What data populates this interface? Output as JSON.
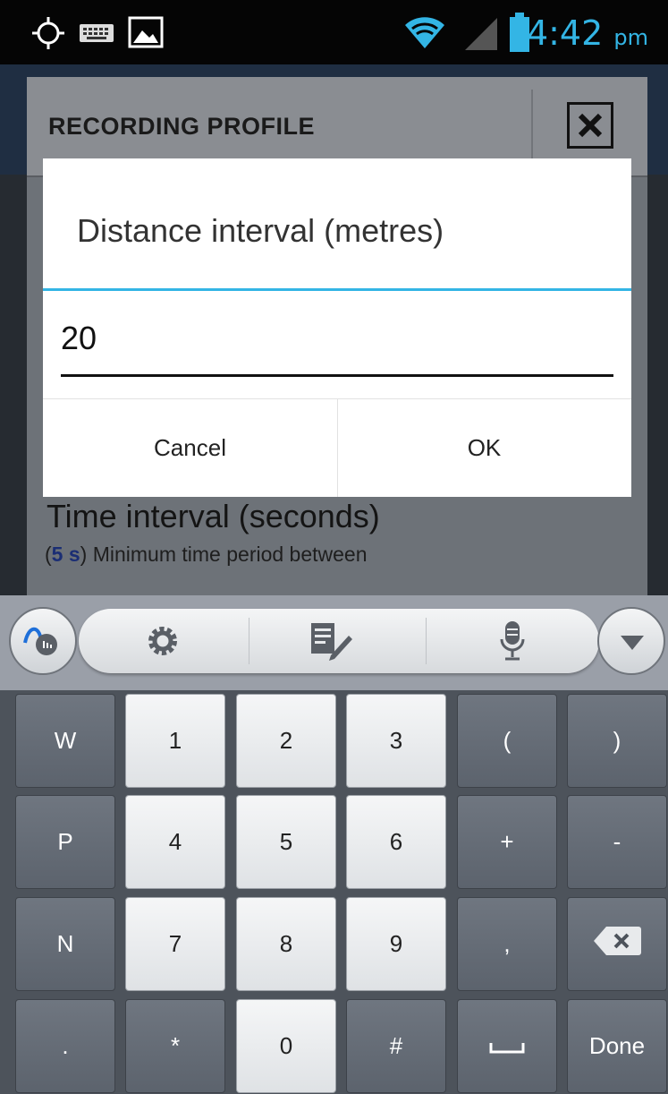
{
  "status_bar": {
    "time": "4:42",
    "ampm": "pm",
    "icons": [
      "gps-icon",
      "keyboard-icon",
      "image-icon",
      "wifi-icon",
      "signal-icon",
      "battery-icon"
    ],
    "accent_color": "#33b5e5"
  },
  "profile_panel": {
    "title": "RECORDING PROFILE",
    "close_icon": "close-icon",
    "time_interval_title": "Time interval (seconds)",
    "time_interval_value": "5 s",
    "time_interval_desc": "Minimum time period between"
  },
  "dialog": {
    "title": "Distance interval (metres)",
    "input_value": "20",
    "cancel_label": "Cancel",
    "ok_label": "OK"
  },
  "keyboard_toolbar": {
    "icons": [
      "swype-icon",
      "settings-icon",
      "edit-icon",
      "microphone-icon",
      "hide-keyboard-icon"
    ]
  },
  "keyboard": {
    "keys": [
      [
        "W",
        "1",
        "2",
        "3",
        "(",
        ")"
      ],
      [
        "P",
        "4",
        "5",
        "6",
        "+",
        "-"
      ],
      [
        "N",
        "7",
        "8",
        "9",
        ",",
        "⌫"
      ],
      [
        ".",
        "*",
        "0",
        "#",
        "␣",
        "Done"
      ]
    ]
  }
}
